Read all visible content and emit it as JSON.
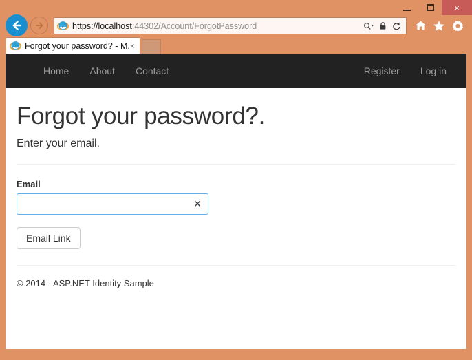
{
  "browser": {
    "window_controls": {
      "minimize_label": "Minimize",
      "maximize_label": "Maximize",
      "close_label": "×"
    },
    "back_label": "Back",
    "forward_label": "Forward",
    "address": {
      "scheme_host": "https://localhost",
      "rest": ":44302/Account/ForgotPassword",
      "full_url": "https://localhost:44302/Account/ForgotPassword"
    },
    "address_icons": [
      "search-dropdown-icon",
      "lock-icon",
      "refresh-icon"
    ],
    "toolbar_icons": [
      "home-icon",
      "favorites-star-icon",
      "settings-gear-icon"
    ],
    "tab": {
      "title": "Forgot your password? - M...",
      "close_label": "×"
    }
  },
  "site_nav": {
    "left_links": [
      {
        "label": "Home"
      },
      {
        "label": "About"
      },
      {
        "label": "Contact"
      }
    ],
    "right_links": [
      {
        "label": "Register"
      },
      {
        "label": "Log in"
      }
    ]
  },
  "page": {
    "title": "Forgot your password?.",
    "subtitle": "Enter your email.",
    "form": {
      "email_label": "Email",
      "email_value": "",
      "email_placeholder": "",
      "clear_label": "✕",
      "submit_label": "Email Link"
    },
    "footer": "© 2014 - ASP.NET Identity Sample"
  },
  "colors": {
    "frame": "#e09264",
    "close_button": "#c75b57",
    "navbar": "#222222",
    "navlink": "#9d9d9d",
    "input_focus_border": "#66afe9",
    "back_button": "#1a8fd0"
  }
}
